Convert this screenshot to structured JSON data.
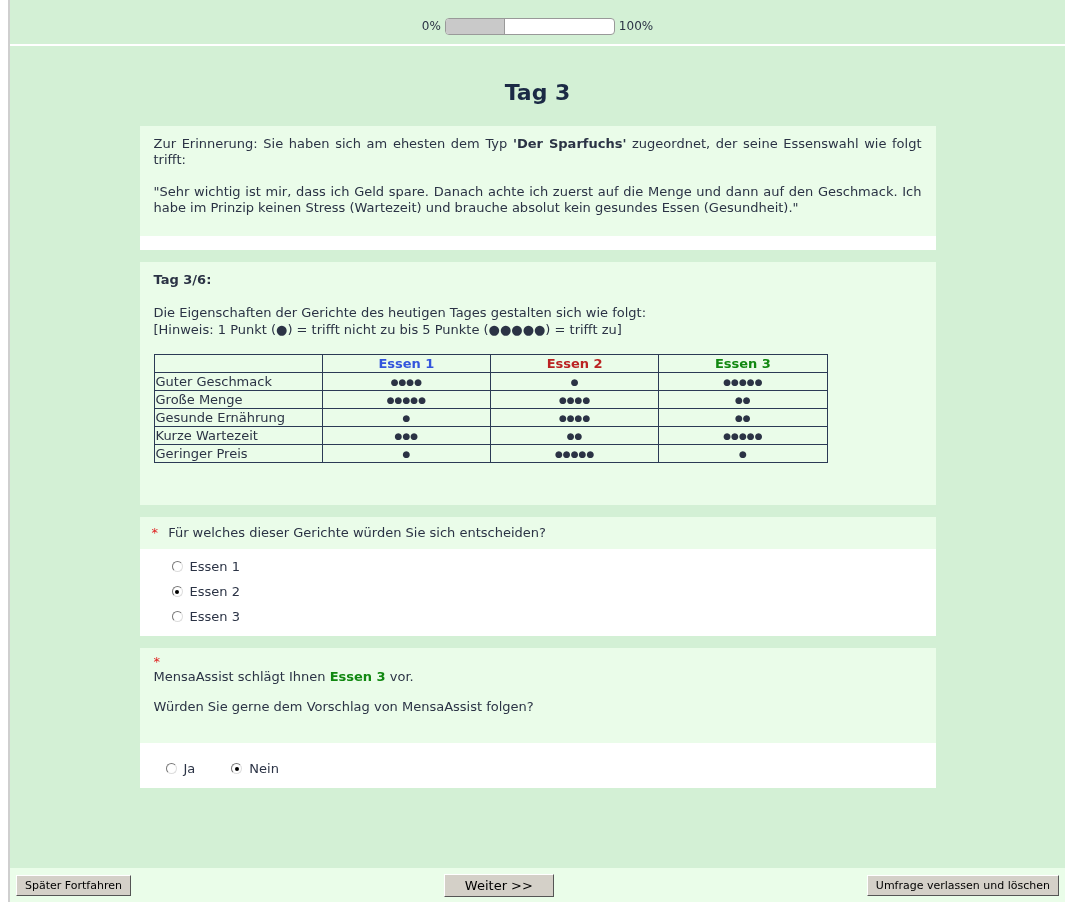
{
  "progress": {
    "start_label": "0%",
    "end_label": "100%",
    "level": 0.35
  },
  "title": "Tag 3",
  "reminder": {
    "intro": "Zur Erinnerung: Sie haben sich am ehesten dem Typ **'Der Sparfuchs'** zugeordnet, der seine Essenswahl wie folgt trifft:",
    "quote": "\"Sehr wichtig ist mir, dass ich Geld spare. Danach achte ich zuerst auf die Menge und dann auf den Geschmack. Ich habe im Prinzip keinen Stress (Wartezeit) und brauche absolut kein gesundes Essen (Gesundheit).\""
  },
  "day": {
    "heading": "Tag 3/6:",
    "description": "Die Eigenschaften der Gerichte des heutigen Tages gestalten sich wie folgt:",
    "hint": "[Hinweis: 1 Punkt (●) = trifft nicht zu bis 5 Punkte (●●●●●) = trifft zu]",
    "table": {
      "columns": [
        {
          "label": "Essen 1",
          "color": "#3355dd"
        },
        {
          "label": "Essen 2",
          "color": "#bb2222"
        },
        {
          "label": "Essen 3",
          "color": "#118811"
        }
      ],
      "rows": [
        {
          "label": "Guter Geschmack",
          "cells": [
            "●●●●",
            "●",
            "●●●●●"
          ]
        },
        {
          "label": "Große Menge",
          "cells": [
            "●●●●●",
            "●●●●",
            "●●"
          ]
        },
        {
          "label": "Gesunde Ernährung",
          "cells": [
            "●",
            "●●●●",
            "●●"
          ]
        },
        {
          "label": "Kurze Wartezeit",
          "cells": [
            "●●●",
            "●●",
            "●●●●●"
          ]
        },
        {
          "label": "Geringer Preis",
          "cells": [
            "●",
            "●●●●●",
            "●"
          ]
        }
      ]
    }
  },
  "question1": {
    "required_mark": "*",
    "text": "Für welches dieser Gerichte würden Sie sich entscheiden?",
    "options": [
      {
        "label": "Essen 1",
        "selected": false
      },
      {
        "label": "Essen 2",
        "selected": true
      },
      {
        "label": "Essen 3",
        "selected": false
      }
    ]
  },
  "question2": {
    "required_mark": "*",
    "suggestion": "MensaAssist schlägt Ihnen **Essen 3** vor.",
    "text": "Würden Sie gerne dem Vorschlag von MensaAssist folgen?",
    "options": [
      {
        "label": "Ja",
        "selected": false
      },
      {
        "label": "Nein",
        "selected": true
      }
    ]
  },
  "footer": {
    "later_button": "Später Fortfahren",
    "next_button": "Weiter >>",
    "exit_button": "Umfrage verlassen und löschen"
  }
}
